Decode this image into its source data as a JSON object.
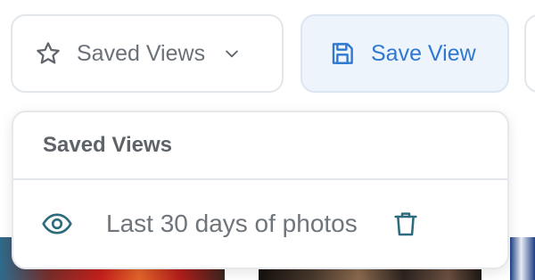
{
  "toolbar": {
    "saved_views_label": "Saved Views",
    "save_view_label": "Save View",
    "icons": {
      "saved_views": "star-icon",
      "saved_views_toggle": "chevron-down-icon",
      "save_view": "floppy-disk-icon"
    }
  },
  "dropdown": {
    "header": "Saved Views",
    "items": [
      {
        "label": "Last 30 days of photos",
        "view_icon": "eye-icon",
        "delete_icon": "trash-icon"
      }
    ]
  },
  "colors": {
    "accent": "#2f78d1",
    "save_button_bg": "#eef4fc",
    "item_icon": "#2e6b7c",
    "muted_text": "#6b7178",
    "border": "#e3e6ea"
  }
}
